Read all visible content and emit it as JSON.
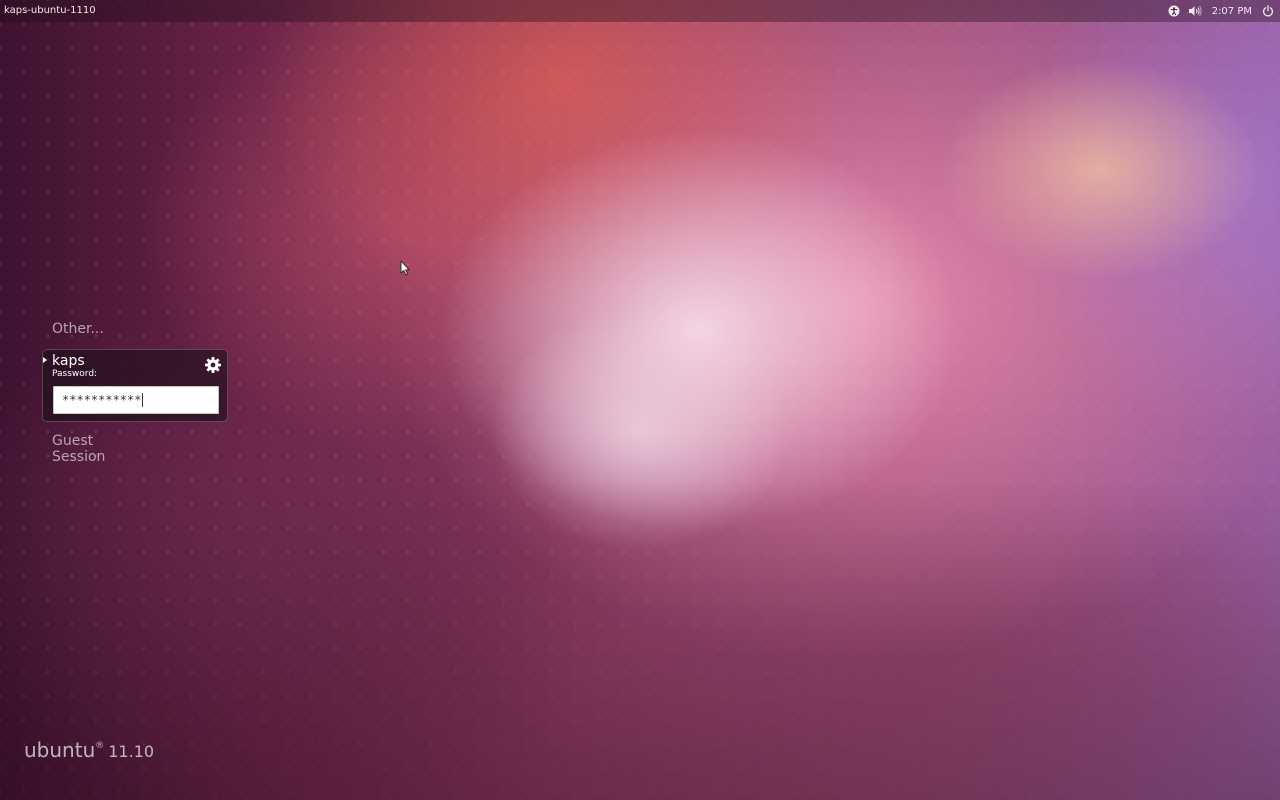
{
  "top_panel": {
    "hostname": "kaps-ubuntu-1110",
    "clock": "2:07 PM",
    "indicators": {
      "accessibility_icon": "accessibility-icon",
      "sound_icon": "sound-icon",
      "power_icon": "power-icon"
    }
  },
  "greeter": {
    "other_label": "Other...",
    "selected_user": {
      "name": "kaps",
      "password_label": "Password:",
      "password_value": "***********",
      "session_icon": "gear-icon"
    },
    "guest_label": "Guest Session"
  },
  "branding": {
    "word": "ubuntu",
    "registered": "®",
    "version": "11.10"
  },
  "colors": {
    "panel_text": "#f2eaee",
    "label_text": "#ffffff",
    "input_bg": "#ffffff"
  }
}
